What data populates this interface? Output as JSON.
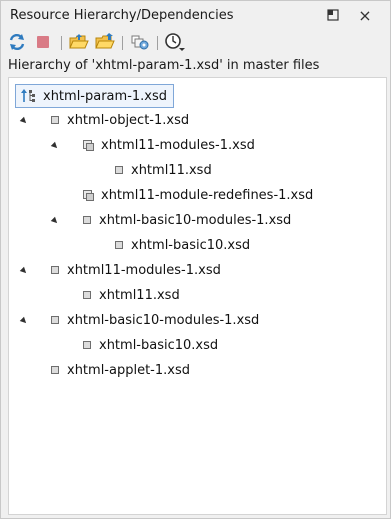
{
  "panel": {
    "title": "Resource Hierarchy/Dependencies",
    "restore_glyph": "▢",
    "close_glyph": "×"
  },
  "toolbar": {
    "icons": [
      "refresh-icon",
      "stop-icon",
      "hierarchy-icon",
      "dependencies-icon",
      "configure-icon",
      "history-icon"
    ]
  },
  "info_text": "Hierarchy of 'xhtml-param-1.xsd' in master files",
  "tree": {
    "root": "xhtml-param-1.xsd",
    "rows": [
      {
        "label": "xhtml-object-1.xsd",
        "icon": "file-icon",
        "expanded": true
      },
      {
        "label": "xhtml11-modules-1.xsd",
        "icon": "redefine-icon",
        "expanded": true
      },
      {
        "label": "xhtml11.xsd",
        "icon": "file-icon",
        "expanded": false
      },
      {
        "label": "xhtml11-module-redefines-1.xsd",
        "icon": "redefine-icon",
        "expanded": false
      },
      {
        "label": "xhtml-basic10-modules-1.xsd",
        "icon": "file-icon",
        "expanded": true
      },
      {
        "label": "xhtml-basic10.xsd",
        "icon": "file-icon",
        "expanded": false
      },
      {
        "label": "xhtml11-modules-1.xsd",
        "icon": "file-icon",
        "expanded": true
      },
      {
        "label": "xhtml11.xsd",
        "icon": "file-icon",
        "expanded": false
      },
      {
        "label": "xhtml-basic10-modules-1.xsd",
        "icon": "file-icon",
        "expanded": true
      },
      {
        "label": "xhtml-basic10.xsd",
        "icon": "file-icon",
        "expanded": false
      },
      {
        "label": "xhtml-applet-1.xsd",
        "icon": "file-icon",
        "expanded": false
      }
    ]
  }
}
